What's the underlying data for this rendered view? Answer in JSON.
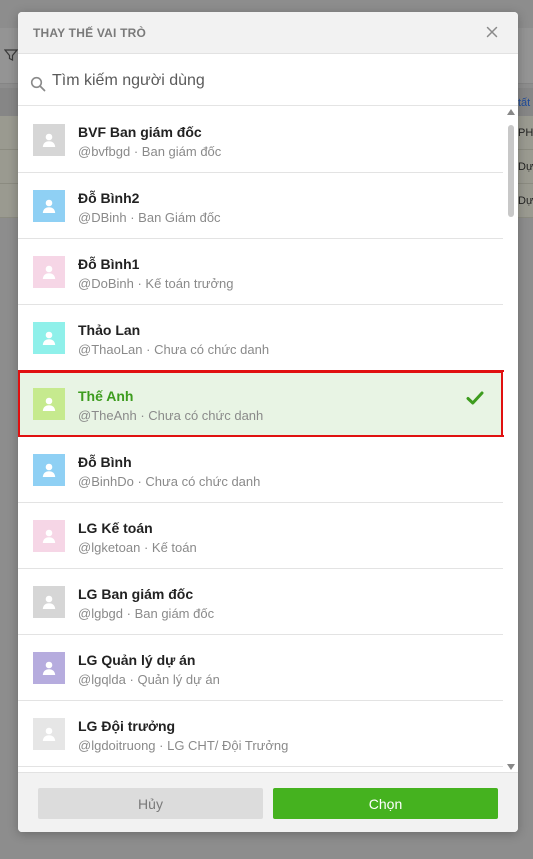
{
  "background": {
    "right_link": "tất",
    "right_texts": [
      "PH",
      "Dự",
      "Dự"
    ]
  },
  "modal": {
    "title": "THAY THẾ VAI TRÒ",
    "close_icon": "close-icon",
    "search": {
      "placeholder": "Tìm kiếm người dùng",
      "value": ""
    },
    "users": [
      {
        "name": "BVF Ban giám đốc",
        "username": "@bvfbgd",
        "role": "Ban giám đốc",
        "avatar_color": "#d6d6d6",
        "selected": false
      },
      {
        "name": "Đỗ Bình2",
        "username": "@DBinh",
        "role": "Ban Giám đốc",
        "avatar_color": "#8fd0f4",
        "selected": false
      },
      {
        "name": "Đỗ Bình1",
        "username": "@DoBinh",
        "role": "Kế toán trưởng",
        "avatar_color": "#f6d6e6",
        "selected": false
      },
      {
        "name": "Thảo Lan",
        "username": "@ThaoLan",
        "role": "Chưa có chức danh",
        "avatar_color": "#8ff0ea",
        "selected": false
      },
      {
        "name": "Thế Anh",
        "username": "@TheAnh",
        "role": "Chưa có chức danh",
        "avatar_color": "#c6ea8e",
        "selected": true
      },
      {
        "name": "Đỗ Bình",
        "username": "@BinhDo",
        "role": "Chưa có chức danh",
        "avatar_color": "#8fd0f4",
        "selected": false
      },
      {
        "name": "LG Kế toán",
        "username": "@lgketoan",
        "role": "Kế toán",
        "avatar_color": "#f6d6e6",
        "selected": false
      },
      {
        "name": "LG Ban giám đốc",
        "username": "@lgbgd",
        "role": "Ban giám đốc",
        "avatar_color": "#d6d6d6",
        "selected": false
      },
      {
        "name": "LG Quản lý dự án",
        "username": "@lgqlda",
        "role": "Quản lý dự án",
        "avatar_color": "#b6acde",
        "selected": false
      },
      {
        "name": "LG Đội trưởng",
        "username": "@lgdoitruong",
        "role": "LG CHT/ Đội Trưởng",
        "avatar_color": "#e6e6e6",
        "selected": false
      }
    ],
    "cancel_label": "Hủy",
    "ok_label": "Chọn"
  },
  "colors": {
    "accent": "#45b21f",
    "selected_bg": "#e8f4e4",
    "selected_border": "#e01010"
  }
}
